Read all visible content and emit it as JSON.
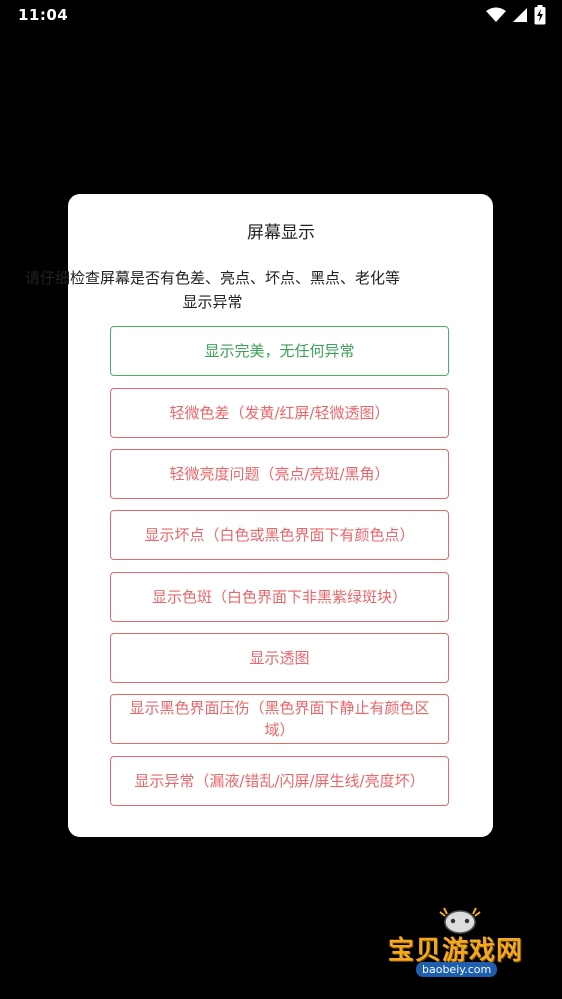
{
  "status_bar": {
    "time": "11:04",
    "icons": [
      "wifi-icon",
      "cellular-signal-icon",
      "battery-charging-icon"
    ]
  },
  "dialog": {
    "title": "屏幕显示",
    "message": "请仔细检查屏幕是否有色差、亮点、坏点、黑点、老化等显示异常",
    "options": [
      {
        "label": "显示完美，无任何异常",
        "status": "good"
      },
      {
        "label": "轻微色差（发黄/红屏/轻微透图）",
        "status": "bad"
      },
      {
        "label": "轻微亮度问题（亮点/亮斑/黑角）",
        "status": "bad"
      },
      {
        "label": "显示坏点（白色或黑色界面下有颜色点）",
        "status": "bad"
      },
      {
        "label": "显示色斑（白色界面下非黑紫绿斑块）",
        "status": "bad"
      },
      {
        "label": "显示透图",
        "status": "bad"
      },
      {
        "label": "显示黑色界面压伤（黑色界面下静止有颜色区域）",
        "status": "bad"
      },
      {
        "label": "显示异常（漏液/错乱/闪屏/屏生线/亮度坏）",
        "status": "bad"
      }
    ],
    "colors": {
      "good": "#3aa355",
      "bad": "#e8676b"
    }
  },
  "watermark": {
    "text": "宝贝游戏网",
    "url": "baobeiy.com"
  }
}
